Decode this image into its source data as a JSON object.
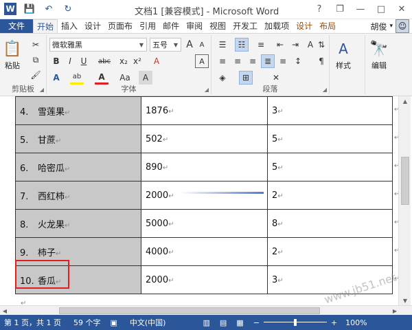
{
  "window": {
    "title": "文档1 [兼容模式] - Microsoft Word",
    "controls": {
      "help": "?",
      "restore": "❐",
      "minimize": "—",
      "maximize": "□",
      "close": "✕"
    }
  },
  "qat": {
    "save": "💾",
    "undo": "↶",
    "redo": "↻"
  },
  "tabs": [
    "文件",
    "开始",
    "插入",
    "设计",
    "页面布",
    "引用",
    "邮件",
    "审阅",
    "视图",
    "开发工",
    "加载项",
    "设计",
    "布局"
  ],
  "user": {
    "name": "胡俊",
    "chevron": "▾"
  },
  "ribbon": {
    "clipboard": {
      "label": "剪贴板",
      "paste_label": "粘贴"
    },
    "font": {
      "label": "字体",
      "font_name": "微软雅黑",
      "font_size": "五号",
      "size_up": "A",
      "size_down": "A",
      "bold": "B",
      "italic": "I",
      "underline": "U",
      "strike": "abc",
      "sub": "x₂",
      "sup": "x²",
      "highlight": "ab",
      "color": "A",
      "case": "Aa",
      "clear": "A"
    },
    "paragraph": {
      "label": "段落"
    },
    "styles": {
      "label": "样式"
    },
    "editing": {
      "label": "编辑"
    }
  },
  "table": {
    "rows": [
      {
        "num": "4.",
        "name": "雪莲果",
        "v1": "1876",
        "v2": "3"
      },
      {
        "num": "5.",
        "name": "甘蔗",
        "v1": "502",
        "v2": "5"
      },
      {
        "num": "6.",
        "name": "哈密瓜",
        "v1": "890",
        "v2": "5"
      },
      {
        "num": "7.",
        "name": "西红柿",
        "v1": "2000",
        "v2": "2"
      },
      {
        "num": "8.",
        "name": "火龙果",
        "v1": "5000",
        "v2": "8"
      },
      {
        "num": "9.",
        "name": "柿子",
        "v1": "4000",
        "v2": "2"
      },
      {
        "num": "10.",
        "name": "香瓜",
        "v1": "2000",
        "v2": "3"
      }
    ],
    "cell_mark": "↵"
  },
  "statusbar": {
    "page": "第 1 页，共 1 页",
    "words": "59 个字",
    "lang": "中文(中国)",
    "zoom": "100%",
    "zoom_minus": "−",
    "zoom_plus": "+"
  },
  "watermark": "www.jb51.net",
  "colors": {
    "accent": "#2b579a",
    "selection": "#c8c8c8",
    "highlight_box": "#e02020"
  }
}
